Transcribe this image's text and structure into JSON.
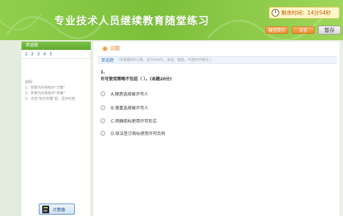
{
  "header": {
    "title": "专业技术人员继续教育随堂练习",
    "timer": "剩余时间：14分54秒",
    "btn_lesson": "随堂提示",
    "btn_submit": "交卷",
    "btn_pause": "暂存"
  },
  "sidebar": {
    "heading": "单选题",
    "numbers": [
      "1",
      "2",
      "3",
      "4",
      "5"
    ],
    "notes_title": "说明：",
    "notes": [
      "1、背景为灰色标示\"已做\"",
      "2、背景为白色标示\"未做\"",
      "3、点击\"标记本题\"后，显示红色"
    ],
    "calculator": "计算器"
  },
  "main": {
    "section_title": "试题",
    "strip_tag": "单选题",
    "strip_desc": "（本类题共5小题，总分100分。多选、错选、不选均不得分。）",
    "question_number": "1.",
    "question_text": "许可使用策略不包括（ ）。(本题20分)",
    "options": [
      "A.随意选择被许可人",
      "B.慎重选择被许可人",
      "C.明确商标使用许可形式",
      "D.依法签订商标使用许可合同"
    ]
  },
  "colors": {
    "header_green": "#7cbf3a",
    "accent_orange": "#e57a17",
    "link_blue": "#2b62a5"
  }
}
